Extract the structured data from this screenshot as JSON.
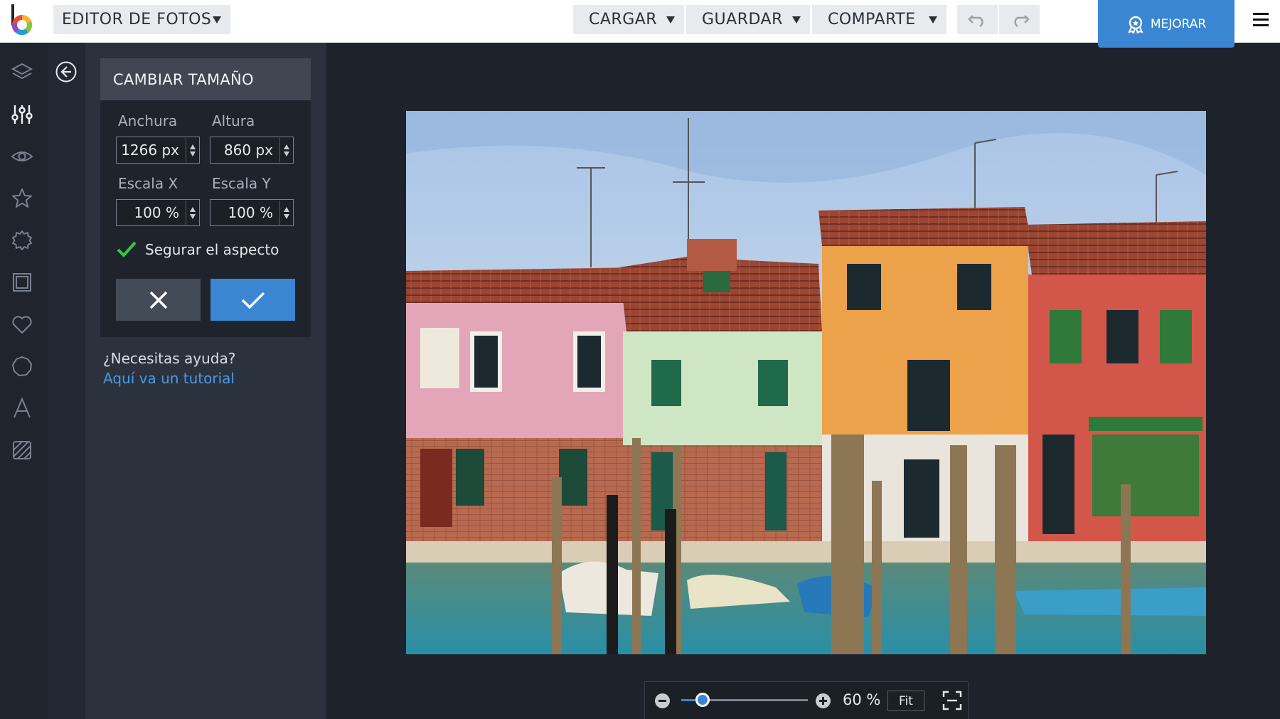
{
  "app": {
    "title": "EDITOR DE FOTOS"
  },
  "toolbar": {
    "cargar": "CARGAR",
    "guardar": "GUARDAR",
    "comparte": "COMPARTE",
    "mejorar": "MEJORAR"
  },
  "sidebar": {
    "icons": [
      "layers-icon",
      "sliders-icon",
      "eye-icon",
      "star-icon",
      "badge-icon",
      "frame-icon",
      "heart-icon",
      "shape-icon",
      "text-icon",
      "texture-icon"
    ],
    "active": "sliders-icon"
  },
  "resize": {
    "title": "CAMBIAR TAMAÑO",
    "width_label": "Anchura",
    "height_label": "Altura",
    "width_value": "1266 px",
    "height_value": "860 px",
    "scale_x_label": "Escala X",
    "scale_y_label": "Escala Y",
    "scale_x_value": "100 %",
    "scale_y_value": "100 %",
    "keep_aspect_label": "Segurar el aspecto",
    "keep_aspect_checked": true
  },
  "help": {
    "question": "¿Necesitas ayuda?",
    "link": "Aquí va un tutorial"
  },
  "zoom": {
    "value_label": "60 %",
    "fit_label": "Fit",
    "slider_fraction": 0.17
  },
  "colors": {
    "accent": "#3a86d2",
    "check": "#2ecc40"
  }
}
